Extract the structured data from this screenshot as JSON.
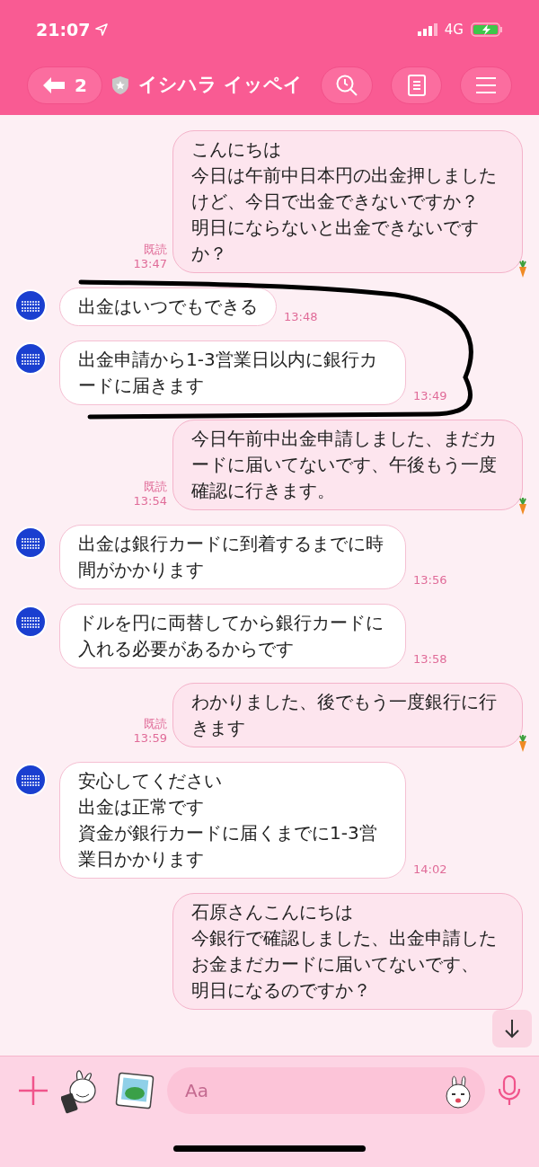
{
  "status_bar": {
    "time": "21:07",
    "network": "4G"
  },
  "header": {
    "back_count": "2",
    "title": "イシハラ イッペイ"
  },
  "messages": [
    {
      "kind": "sent",
      "lines": [
        "こんにちは",
        "今日は午前中日本円の出金押しましたけど、今日で出金できないですか？",
        "明日にならないと出金できないですか？"
      ],
      "read": "既読",
      "time": "13:47"
    },
    {
      "kind": "received",
      "lines": [
        "出金はいつでもできる"
      ],
      "time": "13:48"
    },
    {
      "kind": "received",
      "lines": [
        "出金申請から1-3営業日以内に銀行カードに届きます"
      ],
      "time": "13:49"
    },
    {
      "kind": "sent",
      "lines": [
        "今日午前中出金申請しました、まだカードに届いてないです、午後もう一度確認に行きます。"
      ],
      "read": "既読",
      "time": "13:54"
    },
    {
      "kind": "received",
      "lines": [
        "出金は銀行カードに到着するまでに時間がかかります"
      ],
      "time": "13:56"
    },
    {
      "kind": "received",
      "lines": [
        "ドルを円に両替してから銀行カードに入れる必要があるからです"
      ],
      "time": "13:58"
    },
    {
      "kind": "sent",
      "lines": [
        "わかりました、後でもう一度銀行に行きます"
      ],
      "read": "既読",
      "time": "13:59"
    },
    {
      "kind": "received",
      "lines": [
        "安心してください",
        "出金は正常です",
        "資金が銀行カードに届くまでに1-3営業日かかります"
      ],
      "time": "14:02"
    },
    {
      "kind": "sent",
      "lines": [
        "石原さんこんにちは",
        "今銀行で確認しました、出金申請したお金まだカードに届いてないです、",
        "明日になるのですか？"
      ]
    }
  ],
  "input": {
    "placeholder": "Aa"
  }
}
